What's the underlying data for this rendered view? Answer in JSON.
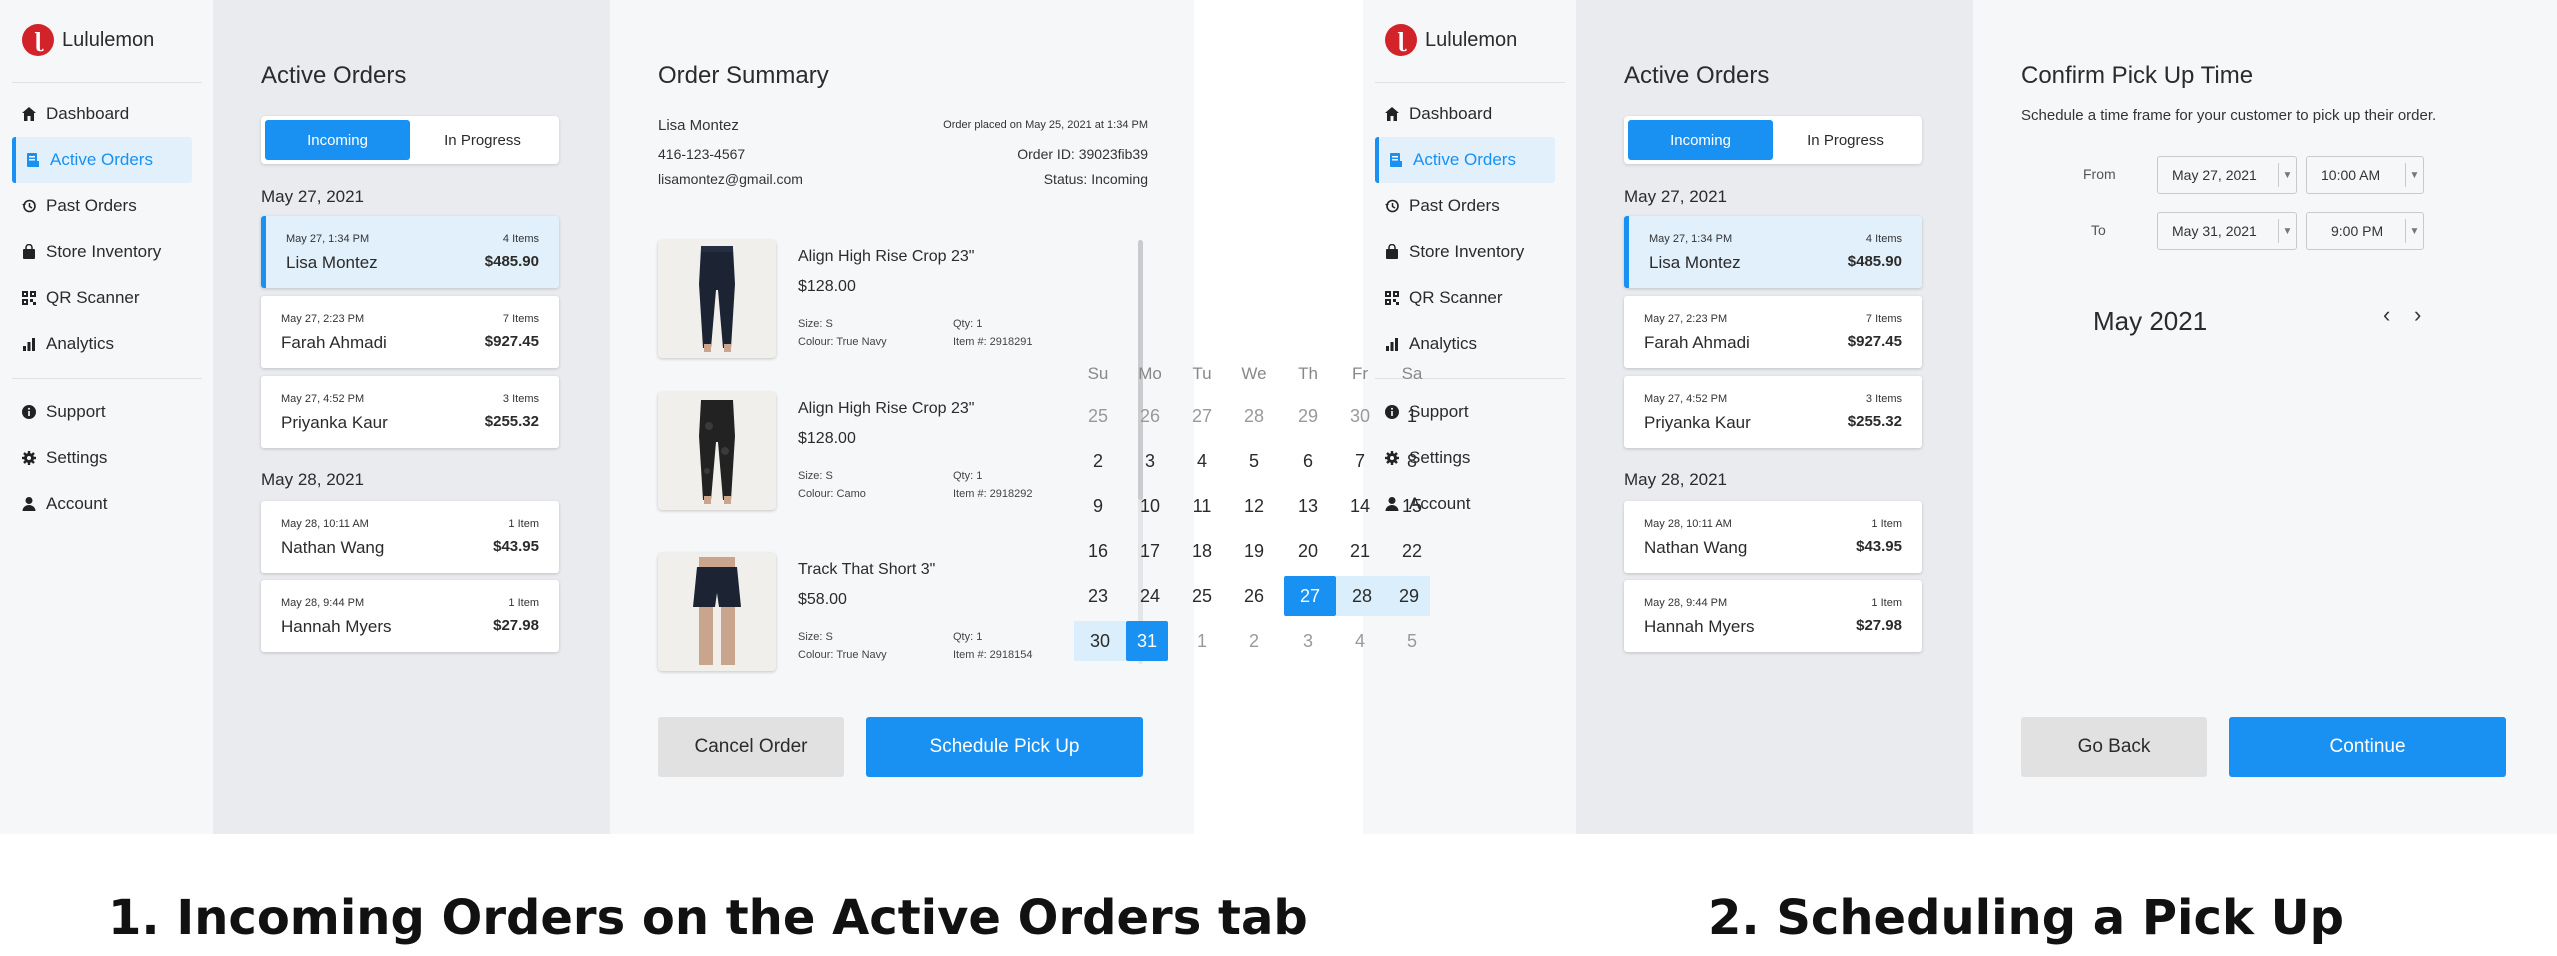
{
  "app": {
    "brand": "Lululemon"
  },
  "nav": {
    "primary": [
      "Dashboard",
      "Active Orders",
      "Past Orders",
      "Store Inventory",
      "QR Scanner",
      "Analytics"
    ],
    "secondary": [
      "Support",
      "Settings",
      "Account"
    ]
  },
  "orders": {
    "title": "Active Orders",
    "tabs": [
      "Incoming",
      "In Progress"
    ],
    "groups": [
      {
        "date": "May 27, 2021",
        "items": [
          {
            "time": "May 27, 1:34 PM",
            "name": "Lisa Montez",
            "count": "4 Items",
            "price": "$485.90"
          },
          {
            "time": "May 27, 2:23 PM",
            "name": "Farah Ahmadi",
            "count": "7 Items",
            "price": "$927.45"
          },
          {
            "time": "May 27, 4:52 PM",
            "name": "Priyanka Kaur",
            "count": "3 Items",
            "price": "$255.32"
          }
        ]
      },
      {
        "date": "May 28, 2021",
        "items": [
          {
            "time": "May 28, 10:11 AM",
            "name": "Nathan Wang",
            "count": "1 Item",
            "price": "$43.95"
          },
          {
            "time": "May 28, 9:44 PM",
            "name": "Hannah Myers",
            "count": "1 Item",
            "price": "$27.98"
          }
        ]
      }
    ]
  },
  "summary": {
    "title": "Order Summary",
    "customer": "Lisa Montez",
    "phone": "416-123-4567",
    "email": "lisamontez@gmail.com",
    "placed": "Order placed on May 25, 2021 at 1:34 PM",
    "order_id": "Order ID: 39023fib39",
    "status": "Status: Incoming",
    "products": [
      {
        "name": "Align High Rise Crop 23\"",
        "price": "$128.00",
        "size": "Size: S",
        "colour": "Colour: True Navy",
        "qty": "Qty: 1",
        "item": "Item #: 2918291"
      },
      {
        "name": "Align High Rise Crop 23\"",
        "price": "$128.00",
        "size": "Size: S",
        "colour": "Colour: Camo",
        "qty": "Qty: 1",
        "item": "Item #: 2918292"
      },
      {
        "name": "Track That Short 3\"",
        "price": "$58.00",
        "size": "Size: S",
        "colour": "Colour: True Navy",
        "qty": "Qty: 1",
        "item": "Item #: 2918154"
      }
    ],
    "cancel": "Cancel Order",
    "schedule": "Schedule Pick Up"
  },
  "pickup": {
    "title": "Confirm Pick Up Time",
    "subtitle": "Schedule a time frame for your customer to pick up their order.",
    "from_label": "From",
    "to_label": "To",
    "from_date": "May 27, 2021",
    "from_time": "10:00 AM",
    "to_date": "May 31, 2021",
    "to_time": "9:00 PM",
    "month": "May 2021",
    "weekdays": [
      "Su",
      "Mo",
      "Tu",
      "We",
      "Th",
      "Fr",
      "Sa"
    ],
    "weeks": [
      [
        "25",
        "26",
        "27",
        "28",
        "29",
        "30",
        "1"
      ],
      [
        "2",
        "3",
        "4",
        "5",
        "6",
        "7",
        "8"
      ],
      [
        "9",
        "10",
        "11",
        "12",
        "13",
        "14",
        "15"
      ],
      [
        "16",
        "17",
        "18",
        "19",
        "20",
        "21",
        "22"
      ],
      [
        "23",
        "24",
        "25",
        "26",
        "27",
        "28",
        "29"
      ],
      [
        "30",
        "31",
        "1",
        "2",
        "3",
        "4",
        "5"
      ]
    ],
    "back": "Go Back",
    "continue": "Continue"
  },
  "captions": {
    "one": "1. Incoming Orders on the Active Orders tab",
    "two": "2. Scheduling a Pick Up"
  },
  "colors": {
    "accent": "#1891f2",
    "brand": "#d2232a",
    "selected_bg": "#e1f0fb"
  }
}
